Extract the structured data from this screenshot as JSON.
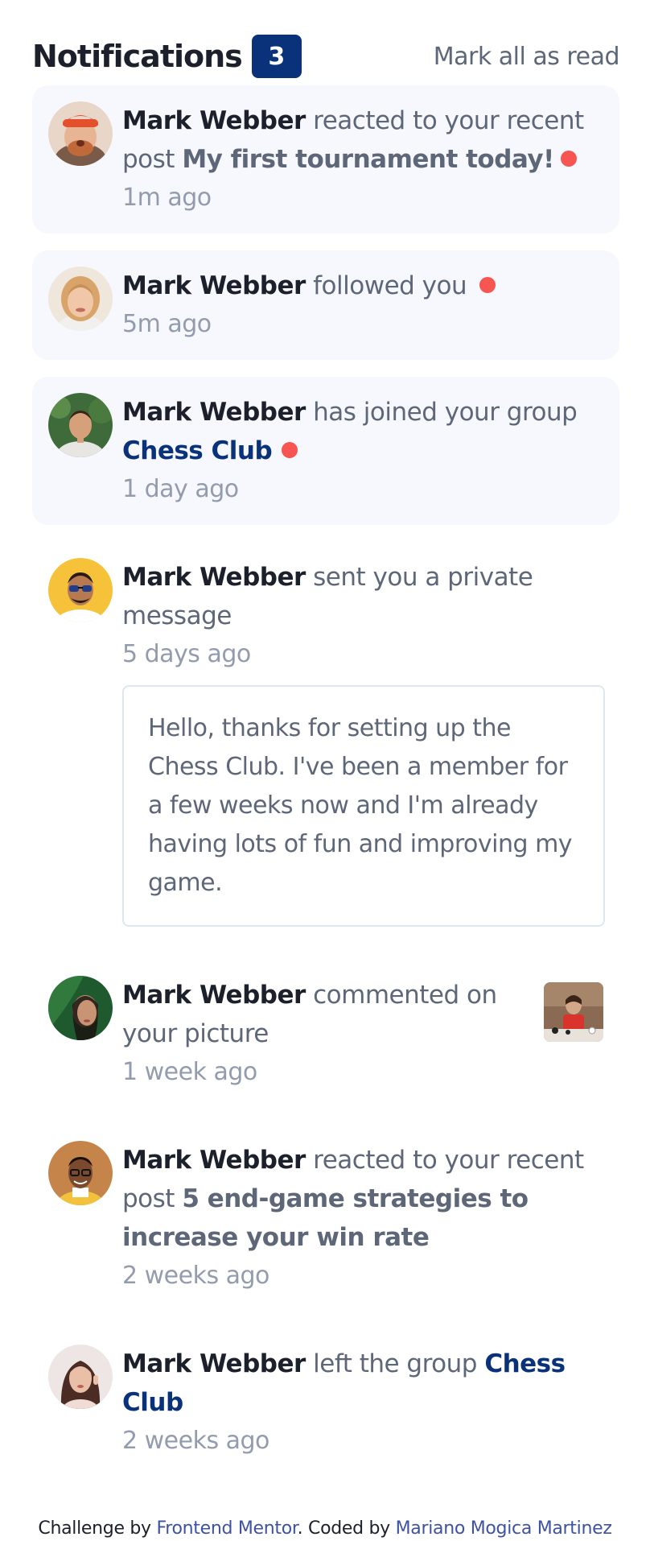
{
  "header": {
    "title": "Notifications",
    "unread_count": "3",
    "mark_all_label": "Mark all as read"
  },
  "notifications": [
    {
      "user": "Mark Webber",
      "action": "reacted to your recent post",
      "post": "My first tournament today!",
      "time": "1m ago",
      "unread": true,
      "avatar_icon": "avatar-mark-webber"
    },
    {
      "user": "Mark Webber",
      "action": "followed you",
      "time": "5m ago",
      "unread": true,
      "avatar_icon": "avatar-angela-gray"
    },
    {
      "user": "Mark Webber",
      "action": "has joined your group",
      "group": "Chess Club",
      "time": "1 day ago",
      "unread": true,
      "avatar_icon": "avatar-jacob-thompson"
    },
    {
      "user": "Mark Webber",
      "action": "sent you a private message",
      "time": "5 days ago",
      "unread": false,
      "message": "Hello, thanks for setting up the Chess Club. I've been a member for a few weeks now and I'm already having lots of fun and improving my game.",
      "avatar_icon": "avatar-rizky-hasanuddin"
    },
    {
      "user": "Mark Webber",
      "action": "commented on your picture",
      "time": "1 week ago",
      "unread": false,
      "avatar_icon": "avatar-kimberly-smith",
      "picture_icon": "chess-picture"
    },
    {
      "user": "Mark Webber",
      "action": "reacted to your recent post",
      "post": "5 end-game strategies to increase your win rate",
      "time": "2 weeks ago",
      "unread": false,
      "avatar_icon": "avatar-nathan-peterson"
    },
    {
      "user": "Mark Webber",
      "action": "left the group",
      "group": "Chess Club",
      "time": "2 weeks ago",
      "unread": false,
      "avatar_icon": "avatar-anna-kim"
    }
  ],
  "footer": {
    "challenge_by": "Challenge by",
    "frontend_mentor": "Frontend Mentor",
    "coded_by": ". Coded by",
    "author": "Mariano Mogica Martinez"
  },
  "colors": {
    "unread_bg": "#f6f8fd",
    "badge": "#0a327b",
    "dot": "#f65552",
    "dark_text": "#1c202b",
    "body_text": "#5e6778",
    "muted_text": "#939cad"
  }
}
